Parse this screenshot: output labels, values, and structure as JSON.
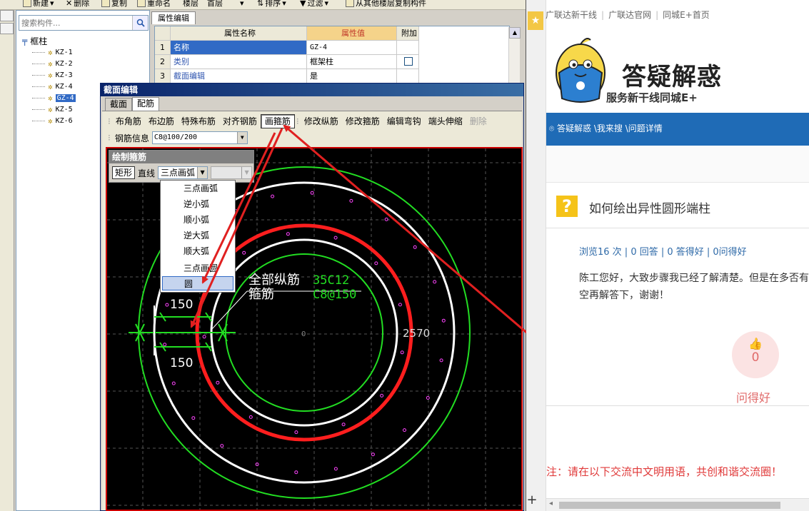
{
  "toolbar": {
    "items": [
      "新建",
      "删除",
      "复制",
      "重命名",
      "楼层",
      "首层",
      "排序",
      "过滤",
      "从其他楼层复制构件"
    ]
  },
  "tree": {
    "search_placeholder": "搜索构件...",
    "root_label": "框柱",
    "root_toggle": "⊟",
    "items": [
      "KZ-1",
      "KZ-2",
      "KZ-3",
      "KZ-4",
      "GZ-4",
      "KZ-5",
      "KZ-6"
    ],
    "selected": "GZ-4"
  },
  "props": {
    "tab": "属性编辑",
    "col_name": "属性名称",
    "col_value": "属性值",
    "col_extra": "附加",
    "rows": [
      {
        "no": "1",
        "name": "名称",
        "value": "GZ-4"
      },
      {
        "no": "2",
        "name": "类别",
        "value": "框架柱"
      },
      {
        "no": "3",
        "name": "截面编辑",
        "value": "是"
      }
    ]
  },
  "dialog": {
    "title": "截面编辑",
    "tabs": [
      "截面",
      "配筋"
    ],
    "rebar_tools": [
      "布角筋",
      "布边筋",
      "特殊布筋",
      "对齐钢筋",
      "画箍筋",
      "修改纵筋",
      "修改箍筋",
      "编辑弯钩",
      "端头伸缩",
      "删除"
    ],
    "active_tool": "画箍筋",
    "rebar_info_label": "钢筋信息",
    "rebar_info_value": "C8@100/200",
    "draw_panel_title": "绘制箍筋",
    "draw_modes": [
      "矩形",
      "直线"
    ],
    "arc_mode": "三点画弧",
    "arc_options": [
      "三点画弧",
      "逆小弧",
      "顺小弧",
      "逆大弧",
      "顺大弧",
      "三点画圆",
      "圆"
    ],
    "highlighted_option": "圆",
    "canvas_labels": {
      "all_long_bars": "全部纵筋",
      "all_long_bars_value": "35C12",
      "stirrups": "箍筋",
      "stirrups_value": "C8@150",
      "dim_top": "150",
      "dim_bottom": "150",
      "dim_right": "2570",
      "center": "0"
    }
  },
  "web": {
    "links": [
      "广联达新干线",
      "广联达官网",
      "同城E+首页"
    ],
    "logo_title": "答疑解惑",
    "logo_sub": "服务新干线同城E+",
    "breadcrumb": "答疑解惑 \\我来搜 \\问题详情",
    "question_mark": "?",
    "question_title": "如何绘出异性圆形端柱",
    "stats": "浏览16 次 | 0 回答 | 0 答得好 | 0问得好",
    "question_text": "陈工您好，大致步骤我已经了解清楚。但是在多否有空再解答下，谢谢！",
    "like_icon": "👍",
    "like_count": "0",
    "like_label": "问得好",
    "notice": "注：请在以下交流中文明用语，共创和谐交流圈！",
    "star_icon": "★",
    "plus_icon": "+"
  },
  "colors": {
    "accent_red": "#e02020",
    "drawing_green": "#22dd22",
    "web_blue": "#1f6bb6",
    "link_blue": "#2f6aa8"
  }
}
